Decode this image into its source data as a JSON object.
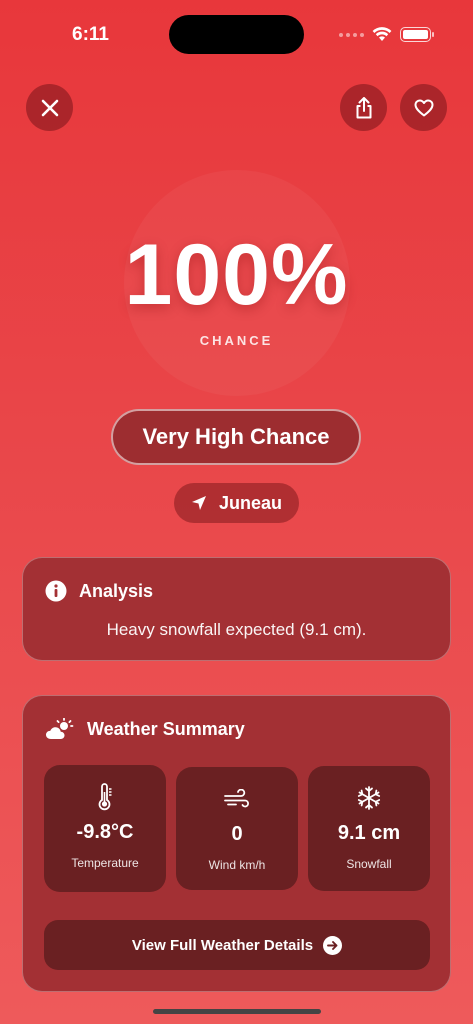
{
  "status": {
    "time": "6:11"
  },
  "hero": {
    "percent": "100%",
    "label": "CHANCE",
    "level": "Very High Chance",
    "location": "Juneau"
  },
  "analysis": {
    "title": "Analysis",
    "text": "Heavy snowfall expected (9.1 cm)."
  },
  "weather": {
    "title": "Weather Summary",
    "tiles": [
      {
        "icon": "thermometer-icon",
        "value": "-9.8°C",
        "label": "Temperature"
      },
      {
        "icon": "wind-icon",
        "value": "0",
        "label": "Wind km/h"
      },
      {
        "icon": "snowflake-icon",
        "value": "9.1 cm",
        "label": "Snowfall"
      }
    ],
    "details_button": "View Full Weather Details"
  }
}
